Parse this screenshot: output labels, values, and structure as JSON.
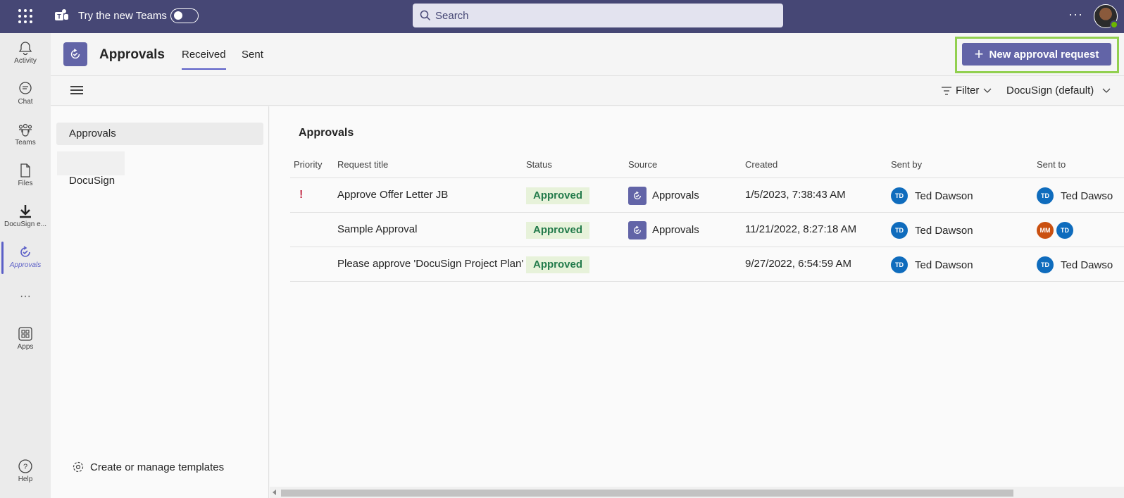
{
  "topbar": {
    "try_new_teams": "Try the new Teams",
    "search_placeholder": "Search",
    "more": "···"
  },
  "rail": {
    "items": [
      {
        "label": "Activity",
        "icon": "bell-icon"
      },
      {
        "label": "Chat",
        "icon": "chat-icon"
      },
      {
        "label": "Teams",
        "icon": "teams-icon"
      },
      {
        "label": "Files",
        "icon": "file-icon"
      },
      {
        "label": "DocuSign e...",
        "icon": "download-icon"
      },
      {
        "label": "Approvals",
        "icon": "approvals-icon"
      },
      {
        "label": "···",
        "icon": "more-icon"
      },
      {
        "label": "Apps",
        "icon": "apps-icon"
      },
      {
        "label": "Help",
        "icon": "help-icon"
      }
    ]
  },
  "header": {
    "title": "Approvals",
    "tabs": [
      {
        "label": "Received"
      },
      {
        "label": "Sent"
      }
    ],
    "new_button": "New approval request"
  },
  "toolbar": {
    "filter": "Filter",
    "provider": "DocuSign (default)"
  },
  "leftpane": {
    "items": [
      {
        "label": "Approvals"
      },
      {
        "label": "DocuSign"
      }
    ],
    "templates": "Create or manage templates"
  },
  "main": {
    "title": "Approvals",
    "columns": [
      "Priority",
      "Request title",
      "Status",
      "Source",
      "Created",
      "Sent by",
      "Sent to"
    ],
    "rows": [
      {
        "priority": "!",
        "title": "Approve Offer Letter JB",
        "status": "Approved",
        "source": "Approvals",
        "created": "1/5/2023, 7:38:43 AM",
        "sent_by": "Ted Dawson",
        "sent_by_initials": "TD",
        "sent_to": "Ted Dawso",
        "sent_to_initials": "TD"
      },
      {
        "priority": "",
        "title": "Sample Approval",
        "status": "Approved",
        "source": "Approvals",
        "created": "11/21/2022, 8:27:18 AM",
        "sent_by": "Ted Dawson",
        "sent_by_initials": "TD",
        "sent_to_initials_1": "MM",
        "sent_to_initials_2": "TD"
      },
      {
        "priority": "",
        "title": "Please approve 'DocuSign Project Plan'",
        "status": "Approved",
        "source": "",
        "created": "9/27/2022, 6:54:59 AM",
        "sent_by": "Ted Dawson",
        "sent_by_initials": "TD",
        "sent_to": "Ted Dawso",
        "sent_to_initials": "TD"
      }
    ]
  },
  "colors": {
    "brand": "#464775",
    "accent": "#6264a7",
    "approved_bg": "#e7f2da",
    "approved_text": "#237b4b",
    "highlight": "#92d050"
  }
}
